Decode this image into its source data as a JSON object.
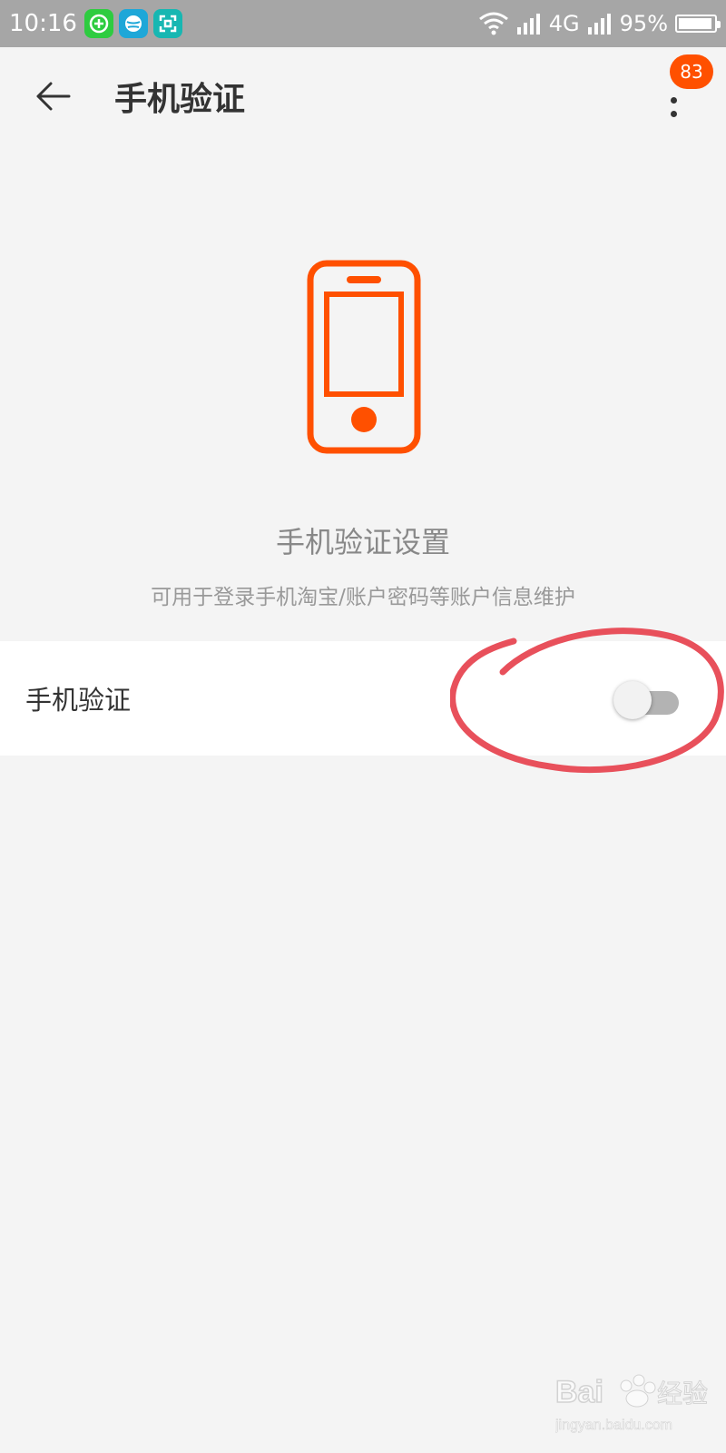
{
  "status_bar": {
    "time": "10:16",
    "network": "4G",
    "battery": "95%",
    "battery_level": 0.95
  },
  "nav": {
    "title": "手机验证",
    "badge_count": "83"
  },
  "hero": {
    "title": "手机验证设置",
    "subtitle": "可用于登录手机淘宝/账户密码等账户信息维护"
  },
  "setting": {
    "label": "手机验证",
    "enabled": false
  },
  "colors": {
    "accent": "#ff5000",
    "annotation": "#e8505b",
    "status_bar_bg": "#a6a6a6"
  },
  "watermark": {
    "text": "Bai 经验",
    "domain": "jingyan.baidu.com"
  }
}
